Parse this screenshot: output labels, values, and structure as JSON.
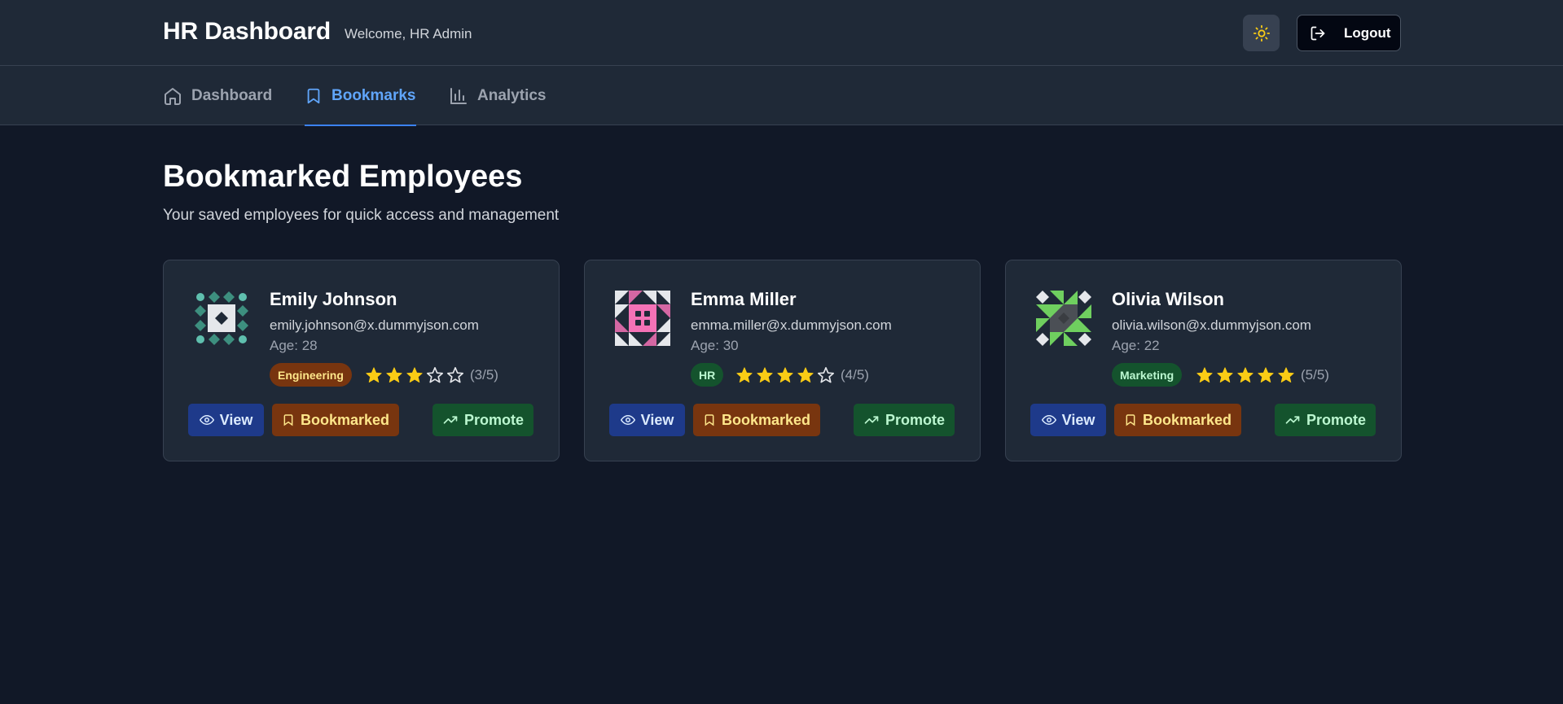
{
  "header": {
    "title": "HR Dashboard",
    "welcome": "Welcome, HR Admin",
    "theme_icon": "sun-icon",
    "logout_label": "Logout"
  },
  "nav": {
    "tabs": [
      {
        "label": "Dashboard",
        "icon": "home-icon",
        "active": false
      },
      {
        "label": "Bookmarks",
        "icon": "bookmark-icon",
        "active": true
      },
      {
        "label": "Analytics",
        "icon": "bar-chart-icon",
        "active": false
      }
    ]
  },
  "main": {
    "title": "Bookmarked Employees",
    "subtitle": "Your saved employees for quick access and management"
  },
  "employees": [
    {
      "name": "Emily Johnson",
      "email": "emily.johnson@x.dummyjson.com",
      "age": "Age: 28",
      "department": "Engineering",
      "rating": 3,
      "rating_text": "(3/5)",
      "dept_colors": {
        "bg": "#78350f",
        "fg": "#fde68a"
      },
      "actions": {
        "view": "View",
        "bookmark": "Bookmarked",
        "promote": "Promote"
      }
    },
    {
      "name": "Emma Miller",
      "email": "emma.miller@x.dummyjson.com",
      "age": "Age: 30",
      "department": "HR",
      "rating": 4,
      "rating_text": "(4/5)",
      "dept_colors": {
        "bg": "#14532d",
        "fg": "#bbf7d0"
      },
      "actions": {
        "view": "View",
        "bookmark": "Bookmarked",
        "promote": "Promote"
      }
    },
    {
      "name": "Olivia Wilson",
      "email": "olivia.wilson@x.dummyjson.com",
      "age": "Age: 22",
      "department": "Marketing",
      "rating": 5,
      "rating_text": "(5/5)",
      "dept_colors": {
        "bg": "#14532d",
        "fg": "#bbf7d0"
      },
      "actions": {
        "view": "View",
        "bookmark": "Bookmarked",
        "promote": "Promote"
      }
    }
  ],
  "colors": {
    "background": "#111827",
    "surface": "#1f2937",
    "accent": "#3b82f6",
    "star": "#facc15"
  }
}
